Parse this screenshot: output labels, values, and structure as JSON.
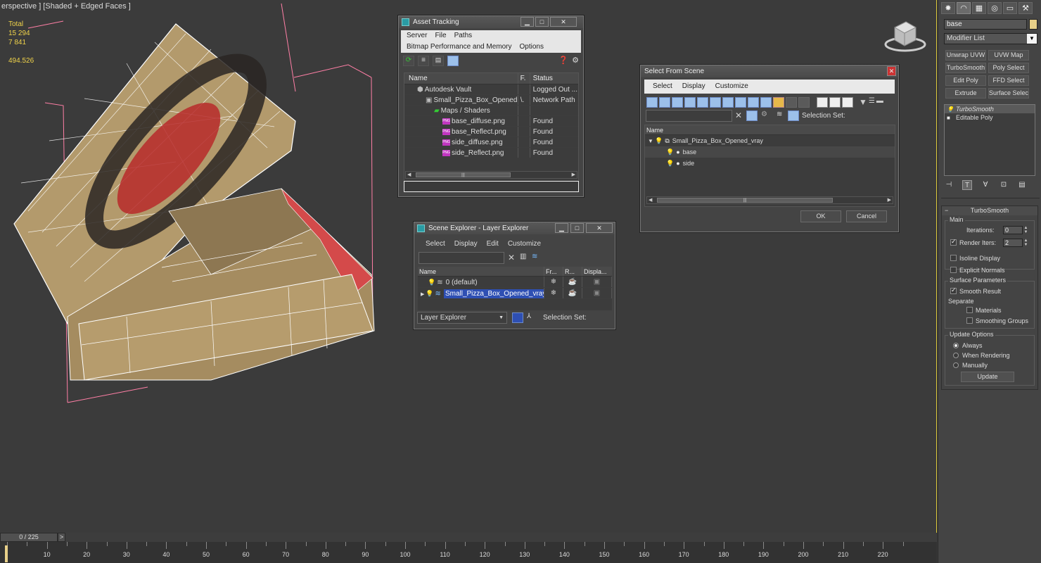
{
  "viewport": {
    "label": "erspective ] [Shaded + Edged Faces ]",
    "stats": {
      "total_label": "Total",
      "polys": "15 294",
      "verts": "7 841",
      "fps": "494.526"
    }
  },
  "asset_tracking": {
    "title": "Asset Tracking",
    "menu_row1": [
      "Server",
      "File",
      "Paths"
    ],
    "menu_row2": [
      "Bitmap Performance and Memory",
      "Options"
    ],
    "columns": {
      "name": "Name",
      "f": "F.",
      "status": "Status"
    },
    "rows": [
      {
        "name": "Autodesk Vault",
        "f": "",
        "status": "Logged Out ...",
        "icon": "vault-icon",
        "indent": 1
      },
      {
        "name": "Small_Pizza_Box_Opened...",
        "f": "\\.",
        "status": "Network Path",
        "icon": "max-file-icon",
        "indent": 2
      },
      {
        "name": "Maps / Shaders",
        "f": "",
        "status": "",
        "icon": "maps-icon",
        "indent": 3
      },
      {
        "name": "base_diffuse.png",
        "f": "",
        "status": "Found",
        "icon": "png-icon",
        "indent": 4
      },
      {
        "name": "base_Reflect.png",
        "f": "",
        "status": "Found",
        "icon": "png-icon",
        "indent": 4
      },
      {
        "name": "side_diffuse.png",
        "f": "",
        "status": "Found",
        "icon": "png-icon",
        "indent": 4
      },
      {
        "name": "side_Reflect.png",
        "f": "",
        "status": "Found",
        "icon": "png-icon",
        "indent": 4
      }
    ]
  },
  "select_from_scene": {
    "title": "Select From Scene",
    "menu": [
      "Select",
      "Display",
      "Customize"
    ],
    "selection_set_label": "Selection Set:",
    "column_name": "Name",
    "tree": [
      {
        "name": "Small_Pizza_Box_Opened_vray",
        "level": 0
      },
      {
        "name": "base",
        "level": 1
      },
      {
        "name": "side",
        "level": 1
      }
    ],
    "ok": "OK",
    "cancel": "Cancel"
  },
  "scene_explorer": {
    "title": "Scene Explorer - Layer Explorer",
    "menu": [
      "Select",
      "Display",
      "Edit",
      "Customize"
    ],
    "columns": {
      "name": "Name",
      "fr": "Fr...",
      "r": "R...",
      "disp": "Displa..."
    },
    "rows": [
      {
        "name": "0 (default)",
        "selected": false
      },
      {
        "name": "Small_Pizza_Box_Opened_vray",
        "selected": true
      }
    ],
    "explorer_type": "Layer Explorer",
    "selection_set_label": "Selection Set:"
  },
  "command_panel": {
    "object_name": "base",
    "modifier_list": "Modifier List",
    "buttons": [
      "Unwrap UVW",
      "UVW Map",
      "TurboSmooth",
      "Poly Select",
      "Edit Poly",
      "FFD Select",
      "Extrude",
      "Surface Select"
    ],
    "stack": [
      "TurboSmooth",
      "Editable Poly"
    ],
    "rollout_title": "TurboSmooth",
    "main_group": "Main",
    "iterations_label": "Iterations:",
    "iterations_value": "0",
    "render_iters_label": "Render Iters:",
    "render_iters_value": "2",
    "isoline": "Isoline Display",
    "explicit_normals": "Explicit Normals",
    "surface_group": "Surface Parameters",
    "smooth_result": "Smooth Result",
    "separate_label": "Separate",
    "materials": "Materials",
    "smoothing_groups": "Smoothing Groups",
    "update_group": "Update Options",
    "always": "Always",
    "when_rendering": "When Rendering",
    "manually": "Manually",
    "update_btn": "Update"
  },
  "timeline": {
    "frame": "0 / 225",
    "next": ">",
    "ticks": [
      "10",
      "20",
      "30",
      "40",
      "50",
      "60",
      "70",
      "80",
      "90",
      "100",
      "110",
      "120",
      "130",
      "140",
      "150",
      "160",
      "170",
      "180",
      "190",
      "200",
      "210",
      "220"
    ]
  },
  "colors": {
    "accent": "#e8d089",
    "selection": "#2e4fb3",
    "box_edge": "#ff7fa6"
  }
}
